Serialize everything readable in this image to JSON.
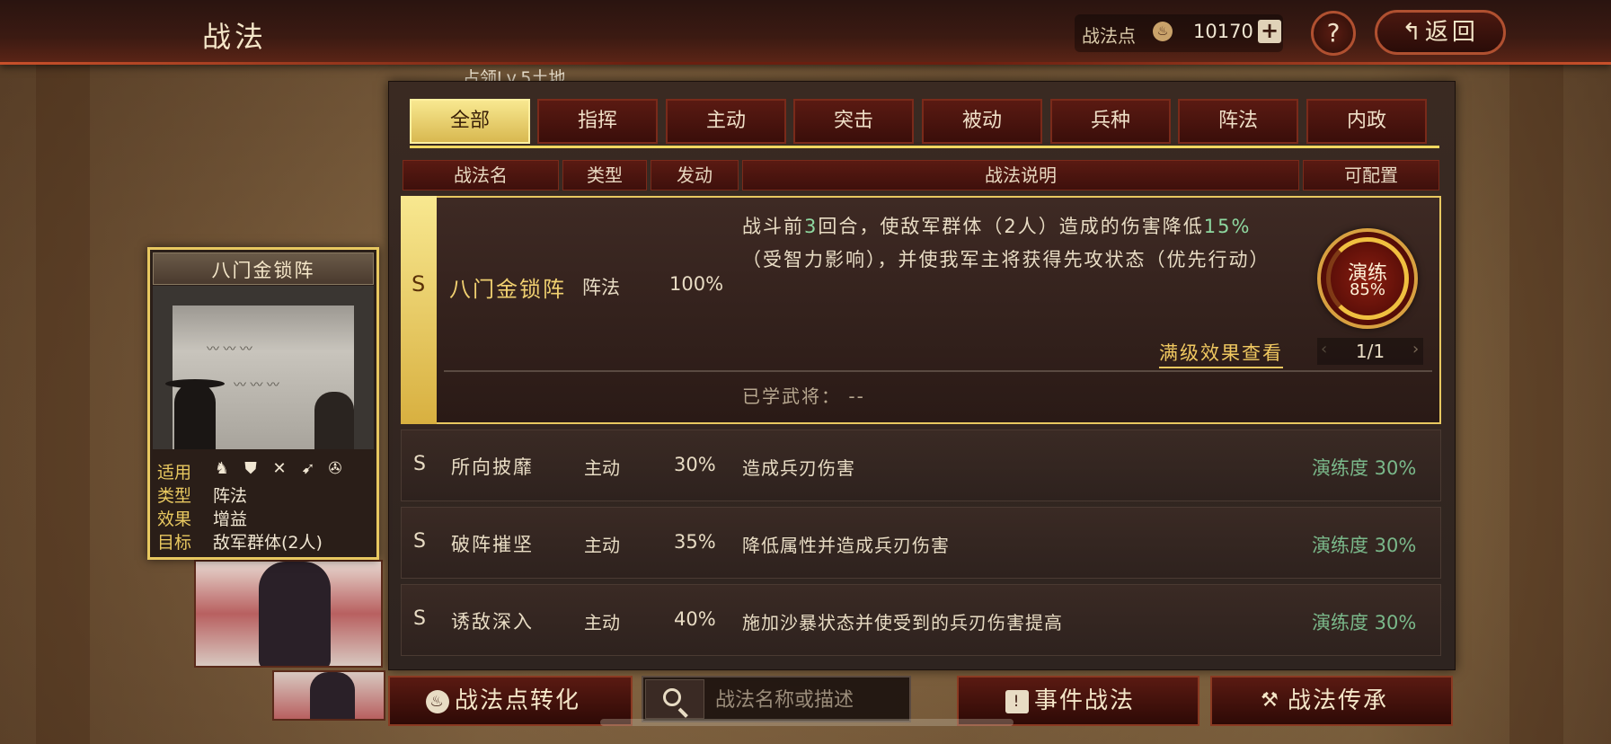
{
  "header": {
    "title": "战法",
    "points_label": "战法点",
    "points_value": "10170",
    "plus_label": "+",
    "help_label": "?",
    "back_label": "返回"
  },
  "occupy_hint": "占领Lv.5土地",
  "tabs": [
    {
      "label": "全部",
      "active": true
    },
    {
      "label": "指挥"
    },
    {
      "label": "主动"
    },
    {
      "label": "突击"
    },
    {
      "label": "被动"
    },
    {
      "label": "兵种"
    },
    {
      "label": "阵法"
    },
    {
      "label": "内政"
    }
  ],
  "columns": {
    "name": "战法名",
    "type": "类型",
    "trigger": "发动",
    "desc": "战法说明",
    "config": "可配置"
  },
  "selected_skill": {
    "grade": "S",
    "name": "八门金锁阵",
    "type": "阵法",
    "rate": "100%",
    "desc_a": "战斗前",
    "desc_b": "3",
    "desc_c": "回合，使敌军群体（2人）造成的伤害降低",
    "desc_d": "15%",
    "desc_e": "（受智力影响），并使我军主将获得先攻状态（优先行动）",
    "drill_label": "演练",
    "drill_pct": "85%",
    "drill_progress": 0.85,
    "max_level_link": "满级效果查看",
    "pager": "1/1",
    "learned": "已学武将： --"
  },
  "skills": [
    {
      "grade": "S",
      "name": "所向披靡",
      "type": "主动",
      "rate": "30%",
      "desc": "造成兵刃伤害",
      "progress": "演练度 30%"
    },
    {
      "grade": "S",
      "name": "破阵摧坚",
      "type": "主动",
      "rate": "35%",
      "desc": "降低属性并造成兵刃伤害",
      "progress": "演练度 30%"
    },
    {
      "grade": "S",
      "name": "诱敌深入",
      "type": "主动",
      "rate": "40%",
      "desc": "施加沙暴状态并使受到的兵刃伤害提高",
      "progress": "演练度 30%"
    }
  ],
  "card": {
    "title": "八门金锁阵",
    "apply_label": "适用",
    "type_label": "类型",
    "type_value": "阵法",
    "effect_label": "效果",
    "effect_value": "增益",
    "target_label": "目标",
    "target_value": "敌军群体(2人)",
    "troop_icons": [
      "cavalry-icon",
      "shield-icon",
      "bow-icon",
      "spear-icon",
      "siege-icon"
    ]
  },
  "bottom": {
    "convert_label": "战法点转化",
    "search_placeholder": "战法名称或描述",
    "event_label": "事件战法",
    "inherit_label": "战法传承"
  },
  "colors": {
    "accent_gold": "#e8c860",
    "highlight_green": "#8ed8a0",
    "progress_green": "#7ab88a",
    "tab_red": "#5a1a12"
  }
}
